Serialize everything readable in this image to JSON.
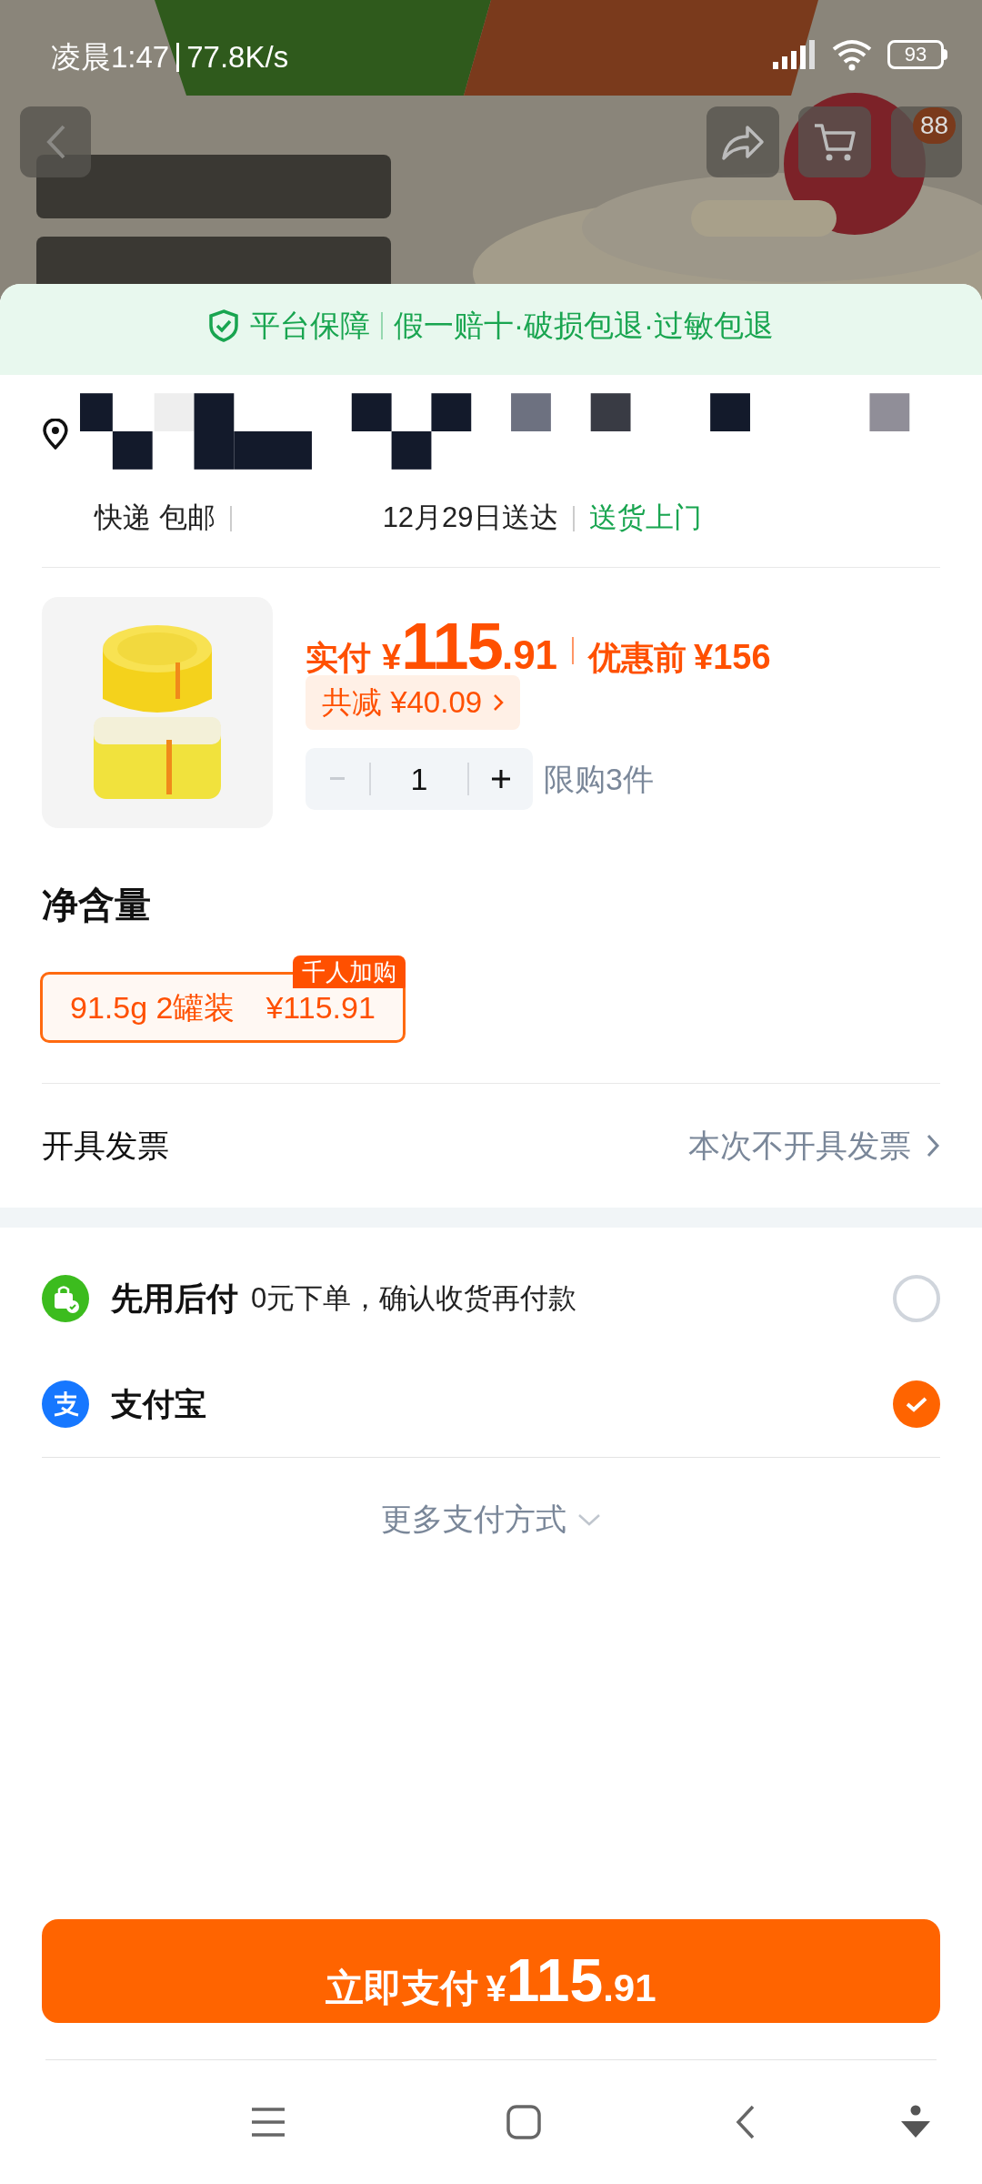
{
  "status_bar": {
    "time": "凌晨1:47",
    "speed": "77.8K/s",
    "battery": "93"
  },
  "header": {
    "more_badge": "88"
  },
  "guarantee": {
    "label": "平台保障",
    "items": "假一赔十·破损包退·过敏包退"
  },
  "delivery": {
    "method": "快递 包邮",
    "arrival": "12月29日送达",
    "service": "送货上门"
  },
  "product": {
    "paid_label": "实付",
    "currency": "¥",
    "price_main": "115",
    "price_decimal": ".91",
    "original_label": "优惠前",
    "original_price": "¥156",
    "discount": "共减 ¥40.09",
    "quantity": "1",
    "limit": "限购3件"
  },
  "spec": {
    "title": "净含量",
    "options": [
      {
        "label": "91.5g 2罐装",
        "price": "¥115.91",
        "badge": "千人加购",
        "selected": true
      }
    ]
  },
  "invoice": {
    "label": "开具发票",
    "value": "本次不开具发票"
  },
  "payments": [
    {
      "kind": "credit",
      "name": "先用后付",
      "note": "0元下单，确认收货再付款",
      "selected": false
    },
    {
      "kind": "alipay",
      "name": "支付宝",
      "selected": true
    }
  ],
  "more_payments": "更多支付方式",
  "pay_button": {
    "label": "立即支付",
    "currency": "¥",
    "amount": "115",
    "decimal": ".91"
  }
}
